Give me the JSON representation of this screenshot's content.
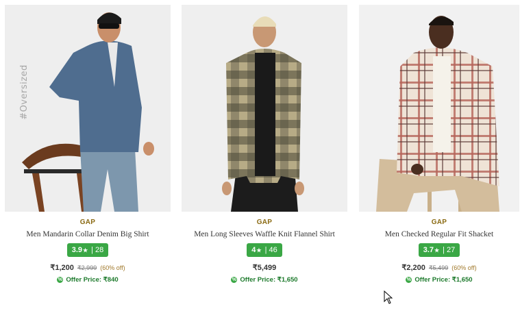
{
  "products": [
    {
      "brand": "GAP",
      "name": "Men Mandarin Collar Denim Big Shirt",
      "rating": "3.9",
      "rating_count": "28",
      "price": "₹1,200",
      "mrp": "₹2,999",
      "discount": "(60% off)",
      "offer_price": "Offer Price: ₹840",
      "image_tag": "#Oversized"
    },
    {
      "brand": "GAP",
      "name": "Men Long Sleeves Waffle Knit Flannel Shirt",
      "rating": "4",
      "rating_count": "46",
      "price": "₹5,499",
      "offer_price": "Offer Price: ₹1,650"
    },
    {
      "brand": "GAP",
      "name": "Men Checked Regular Fit Shacket",
      "rating": "3.7",
      "rating_count": "27",
      "price": "₹2,200",
      "mrp": "₹5,499",
      "discount": "(60% off)",
      "offer_price": "Offer Price: ₹1,650"
    }
  ],
  "colors": {
    "rating_bg": "#3aa745",
    "brand_text": "#8a6a12",
    "offer_text": "#1d7a2c"
  },
  "icons": {
    "star": "star-icon",
    "offer": "offer-tag-icon",
    "cursor": "mouse-pointer-icon"
  }
}
